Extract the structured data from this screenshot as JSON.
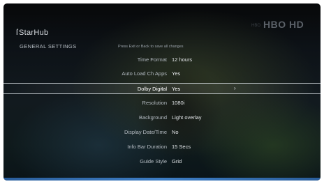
{
  "brand": {
    "logo_mark": "ſ",
    "logo_text": "StarHub",
    "channel_prefix": "HBO",
    "channel_logo": "HBO HD"
  },
  "header": {
    "section_title": "GENERAL SETTINGS",
    "hint": "Press Exit or Back to save all changes"
  },
  "settings": [
    {
      "label": "Time Format",
      "value": "12 hours"
    },
    {
      "label": "Auto Load Ch Apps",
      "value": "Yes"
    },
    {
      "label": "Dolby Digital",
      "value": "Yes"
    },
    {
      "label": "Resolution",
      "value": "1080i"
    },
    {
      "label": "Background",
      "value": "Light overlay"
    },
    {
      "label": "Display Date/Time",
      "value": "No"
    },
    {
      "label": "Info Bar Duration",
      "value": "15 Secs"
    },
    {
      "label": "Guide Style",
      "value": "Grid"
    }
  ],
  "arrows": {
    "left": "‹",
    "right": "›"
  },
  "colors": {
    "highlight_border": "#e6ecf2",
    "bottom_bar": "#3d7dc4"
  }
}
